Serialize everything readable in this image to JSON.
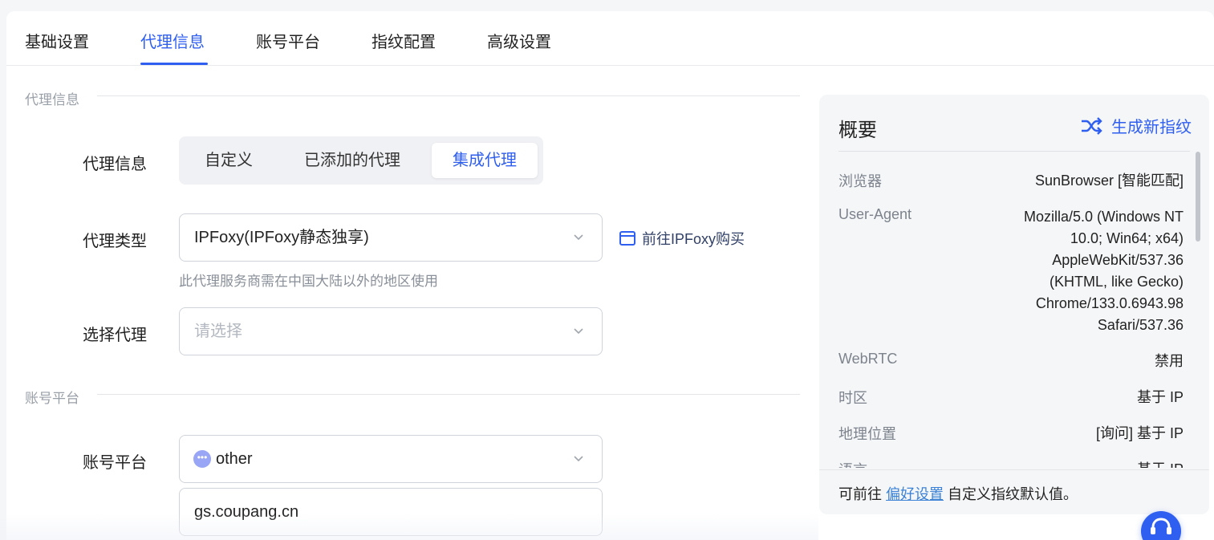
{
  "tabs": [
    {
      "label": "基础设置"
    },
    {
      "label": "代理信息"
    },
    {
      "label": "账号平台"
    },
    {
      "label": "指纹配置"
    },
    {
      "label": "高级设置"
    }
  ],
  "active_tab_index": 1,
  "proxy_section": {
    "title": "代理信息",
    "proxy_info_label": "代理信息",
    "segments": [
      {
        "label": "自定义"
      },
      {
        "label": "已添加的代理"
      },
      {
        "label": "集成代理"
      }
    ],
    "active_segment_index": 2,
    "proxy_type_label": "代理类型",
    "proxy_type_value": "IPFoxy(IPFoxy静态独享)",
    "buy_link": "前往IPFoxy购买",
    "proxy_hint": "此代理服务商需在中国大陆以外的地区使用",
    "select_proxy_label": "选择代理",
    "select_proxy_placeholder": "请选择"
  },
  "account_section": {
    "title": "账号平台",
    "platform_label": "账号平台",
    "platform_value": "other",
    "url_value": "gs.coupang.cn"
  },
  "summary": {
    "title": "概要",
    "generate_button": "生成新指纹",
    "rows": [
      {
        "key": "浏览器",
        "value": "SunBrowser [智能匹配]"
      },
      {
        "key": "User-Agent",
        "value": "Mozilla/5.0 (Windows NT 10.0; Win64; x64) AppleWebKit/537.36 (KHTML, like Gecko) Chrome/133.0.6943.98 Safari/537.36"
      },
      {
        "key": "WebRTC",
        "value": "禁用"
      },
      {
        "key": "时区",
        "value": "基于 IP"
      },
      {
        "key": "地理位置",
        "value": "[询问] 基于 IP"
      },
      {
        "key": "语言",
        "value": "基于 IP"
      }
    ],
    "footer_prefix": "可前往 ",
    "footer_link": "偏好设置",
    "footer_suffix": " 自定义指纹默认值。"
  },
  "colors": {
    "accent": "#2f5ff0",
    "link": "#3b82d6"
  }
}
